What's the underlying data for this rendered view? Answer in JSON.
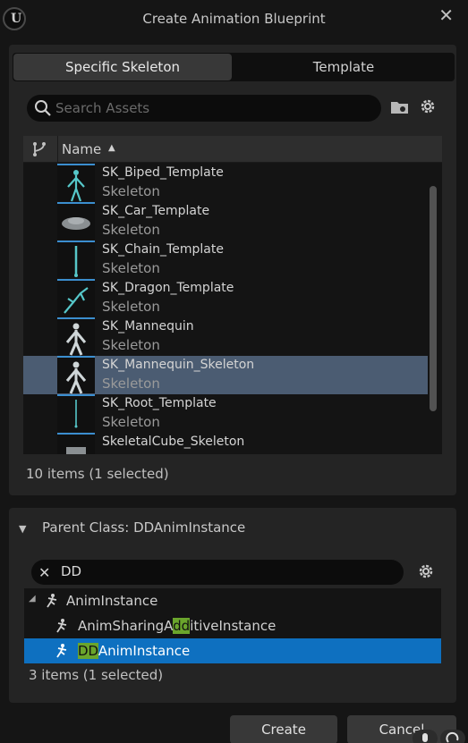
{
  "window": {
    "title": "Create Animation Blueprint",
    "logo_glyph": "U",
    "close_glyph": "✕"
  },
  "tabs": [
    {
      "label": "Specific Skeleton",
      "active": true
    },
    {
      "label": "Template",
      "active": false
    }
  ],
  "search": {
    "placeholder": "Search Assets"
  },
  "list": {
    "column_header": "Name",
    "sort_glyph": "▲",
    "assets": [
      {
        "name": "SK_Biped_Template",
        "type": "Skeleton",
        "selected": false,
        "thumb": "biped-skeleton-thumbnail"
      },
      {
        "name": "SK_Car_Template",
        "type": "Skeleton",
        "selected": false,
        "thumb": "car-skeleton-thumbnail"
      },
      {
        "name": "SK_Chain_Template",
        "type": "Skeleton",
        "selected": false,
        "thumb": "chain-skeleton-thumbnail"
      },
      {
        "name": "SK_Dragon_Template",
        "type": "Skeleton",
        "selected": false,
        "thumb": "dragon-skeleton-thumbnail"
      },
      {
        "name": "SK_Mannequin",
        "type": "Skeleton",
        "selected": false,
        "thumb": "mannequin-skeleton-thumbnail"
      },
      {
        "name": "SK_Mannequin_Skeleton",
        "type": "Skeleton",
        "selected": true,
        "thumb": "mannequin-skeleton-thumbnail"
      },
      {
        "name": "SK_Root_Template",
        "type": "Skeleton",
        "selected": false,
        "thumb": "root-skeleton-thumbnail"
      },
      {
        "name": "SkeletalCube_Skeleton",
        "type": "",
        "selected": false,
        "thumb": "cube-skeleton-thumbnail"
      }
    ],
    "count_text": "10 items (1 selected)"
  },
  "parent_class": {
    "label": "Parent Class: DDAnimInstance",
    "collapse_glyph": "▼",
    "filter_value": "DD",
    "clear_glyph": "✕",
    "tree": [
      {
        "pre": "",
        "hl": "",
        "post": "AnimInstance",
        "level": 0,
        "selected": false
      },
      {
        "pre": "AnimSharingA",
        "hl": "dd",
        "post": "itiveInstance",
        "level": 1,
        "selected": false
      },
      {
        "pre": "",
        "hl": "DD",
        "post": "AnimInstance",
        "level": 1,
        "selected": true
      }
    ],
    "expander_glyph": "◢",
    "count_text": "3 items (1 selected)"
  },
  "buttons": {
    "create": "Create",
    "cancel": "Cancel"
  },
  "colors": {
    "accent": "#0e70c0",
    "selection": "#4b5c72",
    "highlight": "#6aa52c",
    "bone": "#56c7c9"
  }
}
